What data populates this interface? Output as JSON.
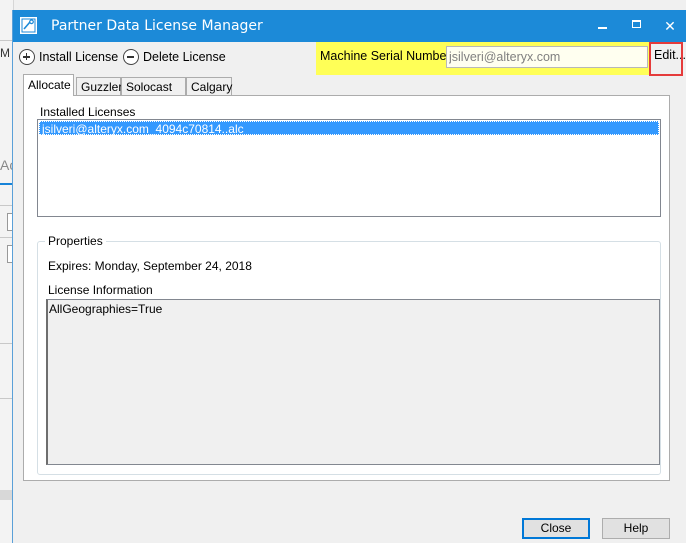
{
  "background_window": {
    "fragment_top": "M",
    "fragment_mid": "Ac"
  },
  "window": {
    "title": "Partner Data License Manager",
    "icon": "license-app-icon"
  },
  "titlebar_buttons": {
    "minimize": "minimize",
    "maximize": "maximize",
    "close": "✕"
  },
  "toolbar": {
    "install_label": "Install License",
    "delete_label": "Delete License",
    "serial_label": "Machine Serial Number",
    "serial_value": "jsilveri@alteryx.com",
    "edit_label": "Edit..."
  },
  "highlights": {
    "serial_color": "#ffff57",
    "edit_color": "#e53b3b"
  },
  "tabs": [
    {
      "label": "Allocate",
      "active": true
    },
    {
      "label": "Guzzler",
      "active": false
    },
    {
      "label": "Solocast",
      "active": false
    },
    {
      "label": "Calgary",
      "active": false
    }
  ],
  "installed": {
    "label": "Installed Licenses",
    "items": [
      "jsilveri@alteryx.com_4094c70814..alc"
    ]
  },
  "properties": {
    "label": "Properties",
    "expires": "Expires: Monday, September 24, 2018",
    "license_info_label": "License Information",
    "license_info": "AllGeographies=True"
  },
  "footer": {
    "close_label": "Close",
    "help_label": "Help"
  }
}
